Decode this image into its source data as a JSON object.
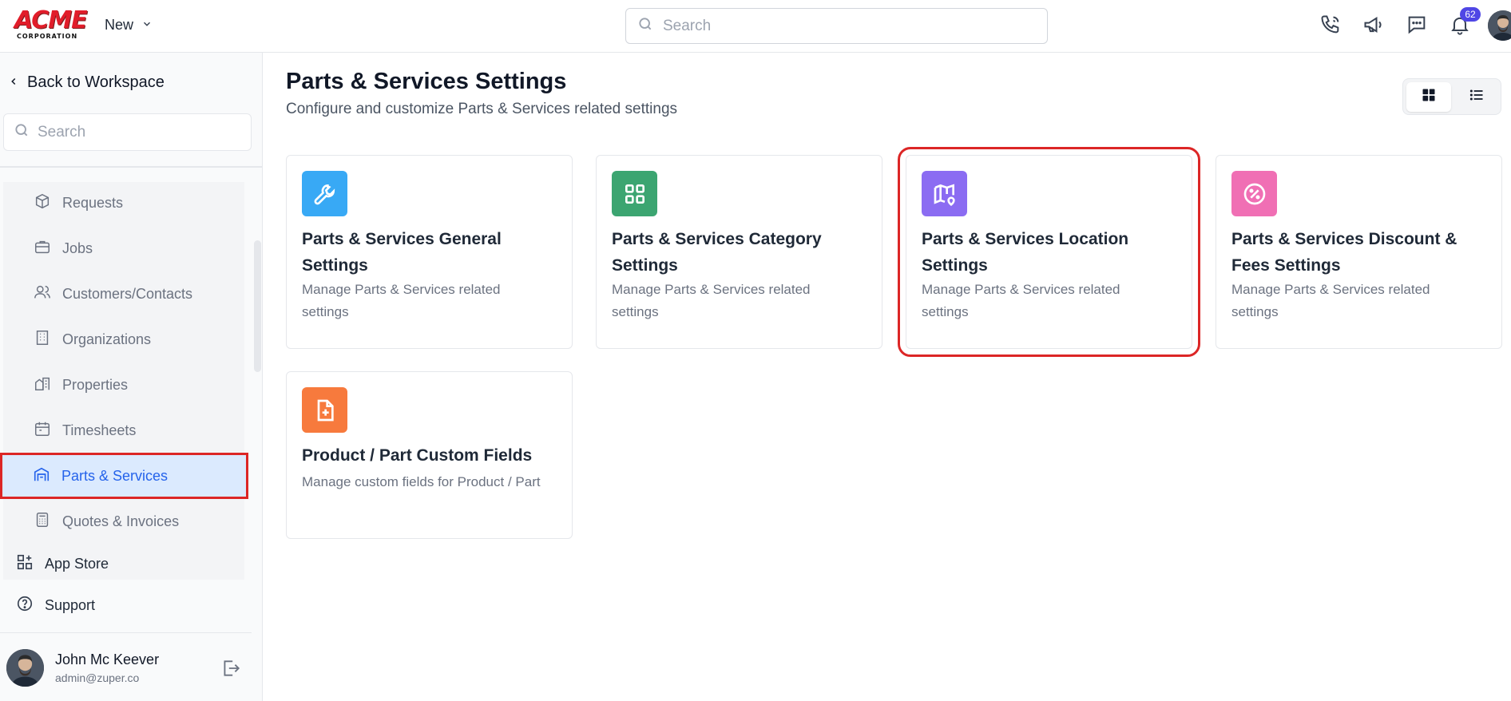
{
  "topbar": {
    "logo_text": "ACME",
    "logo_subtext": "CORPORATION",
    "new_label": "New",
    "search_placeholder": "Search",
    "notification_count": "62"
  },
  "sidebar": {
    "back_label": "Back to Workspace",
    "search_placeholder": "Search",
    "items": [
      {
        "label": "Requests",
        "icon": "box-icon"
      },
      {
        "label": "Jobs",
        "icon": "briefcase-icon"
      },
      {
        "label": "Customers/Contacts",
        "icon": "users-icon"
      },
      {
        "label": "Organizations",
        "icon": "building-icon"
      },
      {
        "label": "Properties",
        "icon": "properties-icon"
      },
      {
        "label": "Timesheets",
        "icon": "calendar-icon"
      },
      {
        "label": "Parts & Services",
        "icon": "warehouse-icon",
        "active": true
      },
      {
        "label": "Quotes & Invoices",
        "icon": "calculator-icon"
      }
    ],
    "app_store_label": "App Store",
    "support_label": "Support",
    "user": {
      "name": "John Mc Keever",
      "email": "admin@zuper.co"
    }
  },
  "main": {
    "title": "Parts & Services Settings",
    "subtitle": "Configure and customize Parts & Services related settings",
    "cards": [
      {
        "title": "Parts & Services General Settings",
        "description": "Manage Parts & Services related settings",
        "icon": "wrench-icon",
        "color": "#38a9f5"
      },
      {
        "title": "Parts & Services Category Settings",
        "description": "Manage Parts & Services related settings",
        "icon": "grid-icon",
        "color": "#3ca571"
      },
      {
        "title": "Parts & Services Location Settings",
        "description": "Manage Parts & Services related settings",
        "icon": "map-pin-icon",
        "color": "#8b6cf2"
      },
      {
        "title": "Parts & Services Discount & Fees Settings",
        "description": "Manage Parts & Services related settings",
        "icon": "percent-icon",
        "color": "#f06fb4"
      },
      {
        "title": "Product / Part Custom Fields",
        "description": "Manage custom fields for Product / Part",
        "icon": "file-plus-icon",
        "color": "#f77a3d"
      }
    ]
  },
  "colors": {
    "accent": "#2563eb",
    "highlight": "#dc2626",
    "badge": "#4f46e5"
  }
}
